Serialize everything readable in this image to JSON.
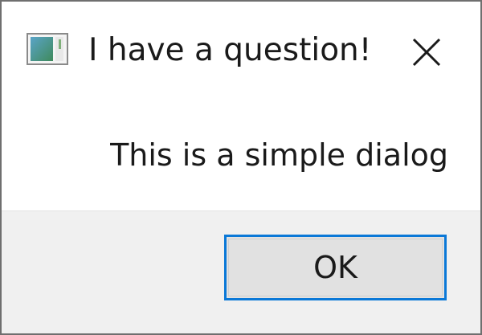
{
  "window": {
    "title": "I have a question!",
    "app_icon": "window-app-icon",
    "close_icon": "close-icon"
  },
  "content": {
    "message": "This is a simple dialog"
  },
  "footer": {
    "ok_label": "OK"
  },
  "colors": {
    "accent": "#0a78d7",
    "footer_bg": "#f0f0f0",
    "button_bg": "#e1e1e1",
    "text": "#1a1a1a"
  }
}
